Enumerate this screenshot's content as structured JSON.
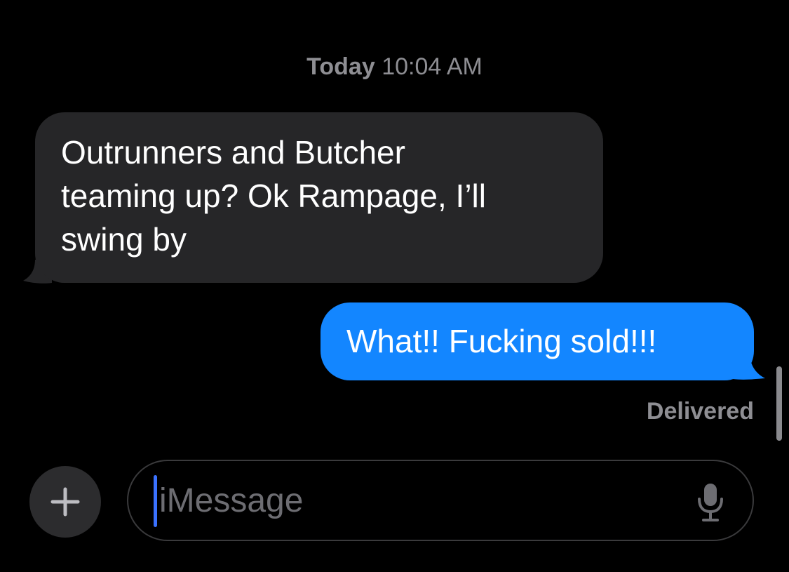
{
  "header": {
    "timestamp_day": "Today",
    "timestamp_time": "10:04 AM"
  },
  "messages": [
    {
      "direction": "received",
      "lines": [
        "Outrunners and Butcher",
        "teaming up? Ok Rampage, I’ll",
        "swing by"
      ]
    },
    {
      "direction": "sent",
      "lines": [
        "What!! Fucking sold!!!"
      ]
    }
  ],
  "status": {
    "delivered_label": "Delivered"
  },
  "composer": {
    "placeholder": "iMessage",
    "plus_icon": "plus-icon",
    "mic_icon": "microphone-icon"
  },
  "colors": {
    "background": "#000000",
    "received_bubble": "#262628",
    "sent_bubble": "#1386ff",
    "secondary_text": "#8e8e93",
    "caret": "#3b72ff"
  }
}
